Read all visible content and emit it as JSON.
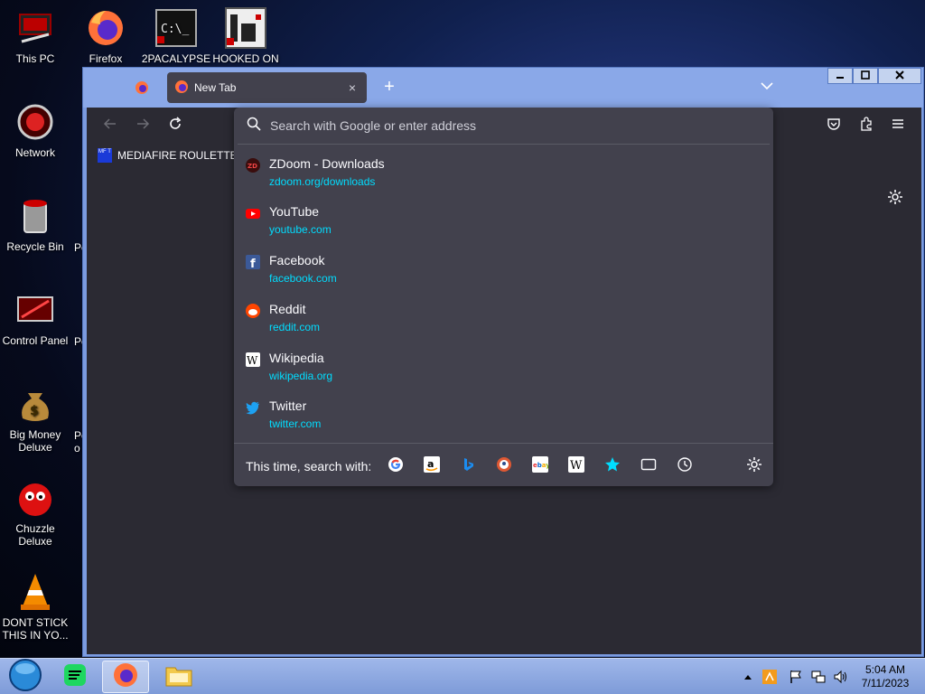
{
  "desktop": {
    "icons": [
      {
        "label": "This PC"
      },
      {
        "label": "Firefox"
      },
      {
        "label": "2PACALYPSE"
      },
      {
        "label": "HOOKED ON"
      },
      {
        "label": "Network"
      },
      {
        "label": "Recycle Bin"
      },
      {
        "label": "Control Panel"
      },
      {
        "label": "Big Money Deluxe"
      },
      {
        "label": "Chuzzle Deluxe"
      },
      {
        "label": "DONT STICK THIS IN YO..."
      }
    ],
    "clipped": [
      "Pe",
      "Pe",
      "Pe",
      "o"
    ]
  },
  "browser": {
    "tab": {
      "title": "New Tab",
      "close": "×"
    },
    "new_tab": "+",
    "bookmark": {
      "label": "MEDIAFIRE ROULETTER",
      "favicon_text": "MF T"
    },
    "urlbar": {
      "placeholder": "Search with Google or enter address",
      "results": [
        {
          "title": "ZDoom - Downloads",
          "url": "zdoom.org/downloads",
          "icon": "zdoom-favicon"
        },
        {
          "title": "YouTube",
          "url": "youtube.com",
          "icon": "youtube-favicon"
        },
        {
          "title": "Facebook",
          "url": "facebook.com",
          "icon": "facebook-favicon"
        },
        {
          "title": "Reddit",
          "url": "reddit.com",
          "icon": "reddit-favicon"
        },
        {
          "title": "Wikipedia",
          "url": "wikipedia.org",
          "icon": "wikipedia-favicon"
        },
        {
          "title": "Twitter",
          "url": "twitter.com",
          "icon": "twitter-favicon"
        }
      ],
      "search_with_label": "This time, search with:",
      "engines": [
        "google",
        "amazon",
        "bing",
        "duckduckgo",
        "ebay",
        "wikipedia",
        "bookmarks",
        "tabs",
        "history"
      ]
    }
  },
  "taskbar": {
    "time": "5:04 AM",
    "date": "7/11/2023"
  },
  "colors": {
    "toolbar": "#2b2a33",
    "popup": "#42414d",
    "link": "#00ddff",
    "accent": "#0df"
  }
}
